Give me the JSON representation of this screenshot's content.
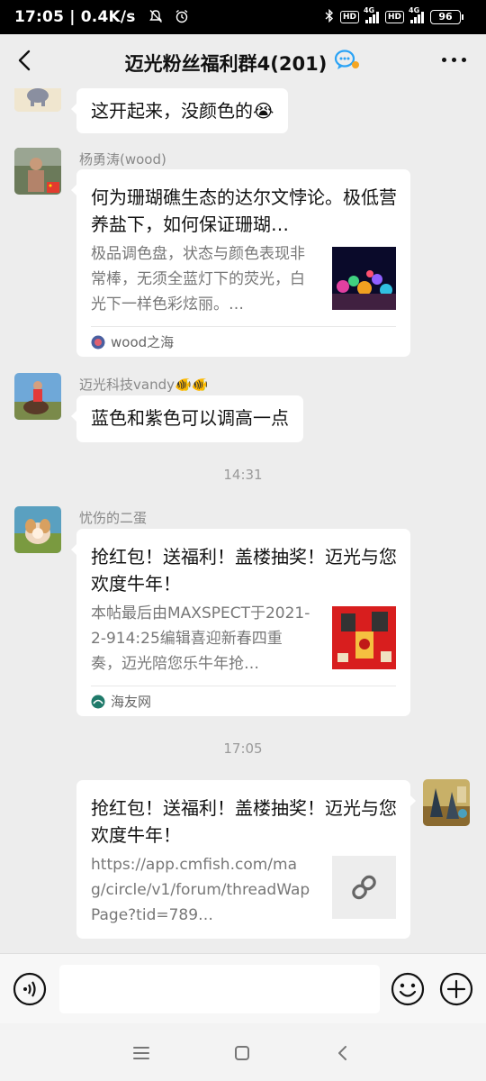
{
  "status_bar": {
    "time": "17:05",
    "speed": "0.4K/s",
    "battery": "96",
    "network_label": "4G",
    "hd_label": "HD"
  },
  "header": {
    "title": "迈光粉丝福利群4(201)"
  },
  "messages": [
    {
      "type": "text",
      "sender": "",
      "text": "这开起来，没颜色的😭"
    },
    {
      "type": "card",
      "sender": "杨勇涛(wood)",
      "title": "何为珊瑚礁生态的达尔文悖论。极低营养盐下，如何保证珊瑚…",
      "desc": "极品调色盘，状态与颜色表现非常棒，无须全蓝灯下的荧光，白光下一样色彩炫丽。…",
      "source": "wood之海"
    },
    {
      "type": "text",
      "sender": "迈光科技vandy🐠🐠",
      "text": "蓝色和紫色可以调高一点"
    },
    {
      "type": "time",
      "text": "14:31"
    },
    {
      "type": "card",
      "sender": "忧伤的二蛋",
      "title": "抢红包！送福利！盖楼抽奖！迈光与您欢度牛年！",
      "desc": "本帖最后由MAXSPECT于2021-2-914:25编辑喜迎新春四重奏，迈光陪您乐牛年抢…",
      "source": "海友网"
    },
    {
      "type": "time",
      "text": "17:05"
    },
    {
      "type": "card",
      "sender": "",
      "title": "抢红包！送福利！盖楼抽奖！迈光与您欢度牛年！",
      "desc": "https://app.cmfish.com/mag/circle/v1/forum/threadWapPage?tid=789…",
      "source": ""
    }
  ],
  "icons": {
    "back": "chevron-left-icon",
    "more": "more-dots-icon",
    "voice": "voice-icon",
    "emoji": "emoji-icon",
    "add": "plus-icon",
    "link": "link-icon"
  },
  "colors": {
    "background": "#ededed",
    "bubble": "#ffffff",
    "status_bar": "#000000"
  }
}
